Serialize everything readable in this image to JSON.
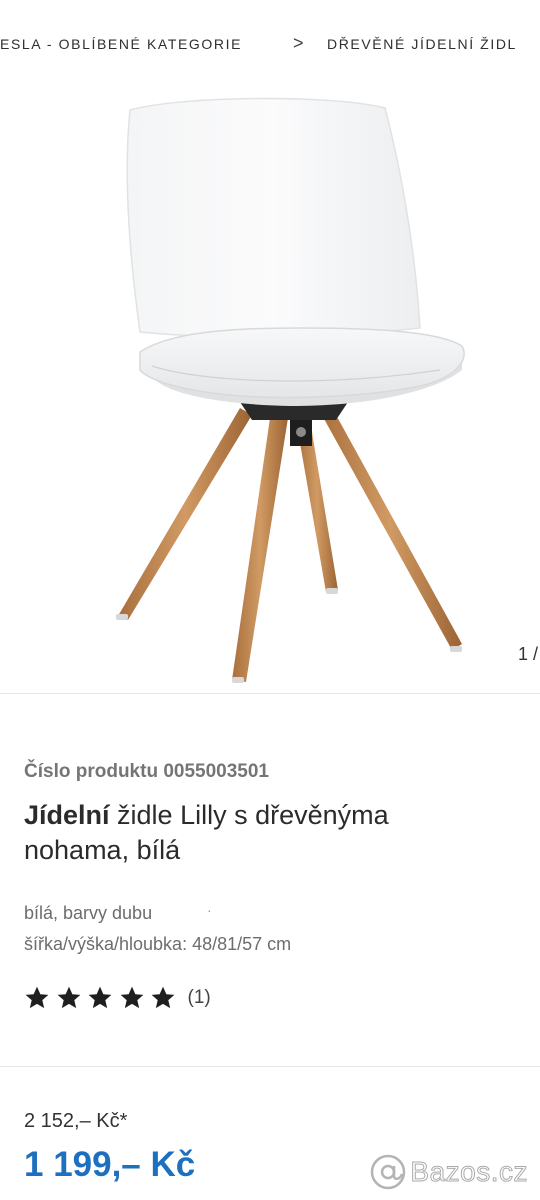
{
  "breadcrumb": {
    "items": [
      "ESLA - OBLÍBENÉ KATEGORIE",
      "DŘEVĚNÉ JÍDELNÍ ŽIDL"
    ],
    "separator": ">"
  },
  "gallery": {
    "counter": "1 /",
    "image_alt": "white dining chair with wooden legs"
  },
  "product": {
    "number_label": "Číslo produktu 0055003501",
    "title_bold": "Jídelní",
    "title_rest": " židle Lilly s dřevěnýma nohama, bílá",
    "attributes": [
      "bílá, barvy dubu",
      "šířka/výška/hloubka: 48/81/57 cm"
    ],
    "attr_separator": "·",
    "rating": {
      "stars": 5,
      "max": 5,
      "count_label": "(1)"
    }
  },
  "price": {
    "old": "2 152,– Kč*",
    "current": "1 199,– Kč"
  },
  "watermark": {
    "text": "Bazos.cz",
    "icon": "at-sign-icon"
  },
  "colors": {
    "price_blue": "#1d6fc0",
    "star": "#1f1f1f",
    "muted_text": "#757575",
    "divider": "#e2e6e8"
  }
}
